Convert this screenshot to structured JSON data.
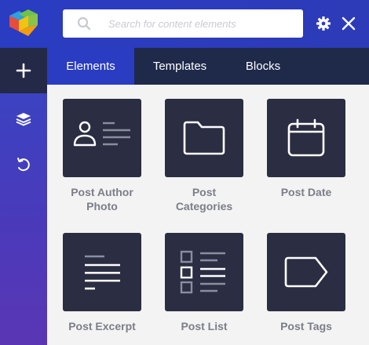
{
  "header": {
    "logo_icon": "visual-composer-logo-icon",
    "search": {
      "placeholder": "Search for content elements",
      "value": ""
    },
    "settings_icon": "gear-icon",
    "close_icon": "close-icon"
  },
  "sidebar": {
    "items": [
      {
        "icon": "plus-icon",
        "active": true
      },
      {
        "icon": "layers-icon",
        "active": false
      },
      {
        "icon": "undo-icon",
        "active": false
      }
    ]
  },
  "tabs": [
    {
      "label": "Elements",
      "active": true
    },
    {
      "label": "Templates",
      "active": false
    },
    {
      "label": "Blocks",
      "active": false
    }
  ],
  "elements": [
    {
      "label": "Post Author Photo",
      "icon": "author-photo-icon"
    },
    {
      "label": "Post Categories",
      "icon": "folder-icon"
    },
    {
      "label": "Post Date",
      "icon": "calendar-icon"
    },
    {
      "label": "Post Excerpt",
      "icon": "text-lines-icon"
    },
    {
      "label": "Post List",
      "icon": "checklist-icon"
    },
    {
      "label": "Post Tags",
      "icon": "tag-icon"
    }
  ],
  "colors": {
    "accent": "#2a3cc2",
    "tab_bar": "#1f2a4a",
    "tile": "#2b2e42",
    "label": "#7b7e88"
  }
}
